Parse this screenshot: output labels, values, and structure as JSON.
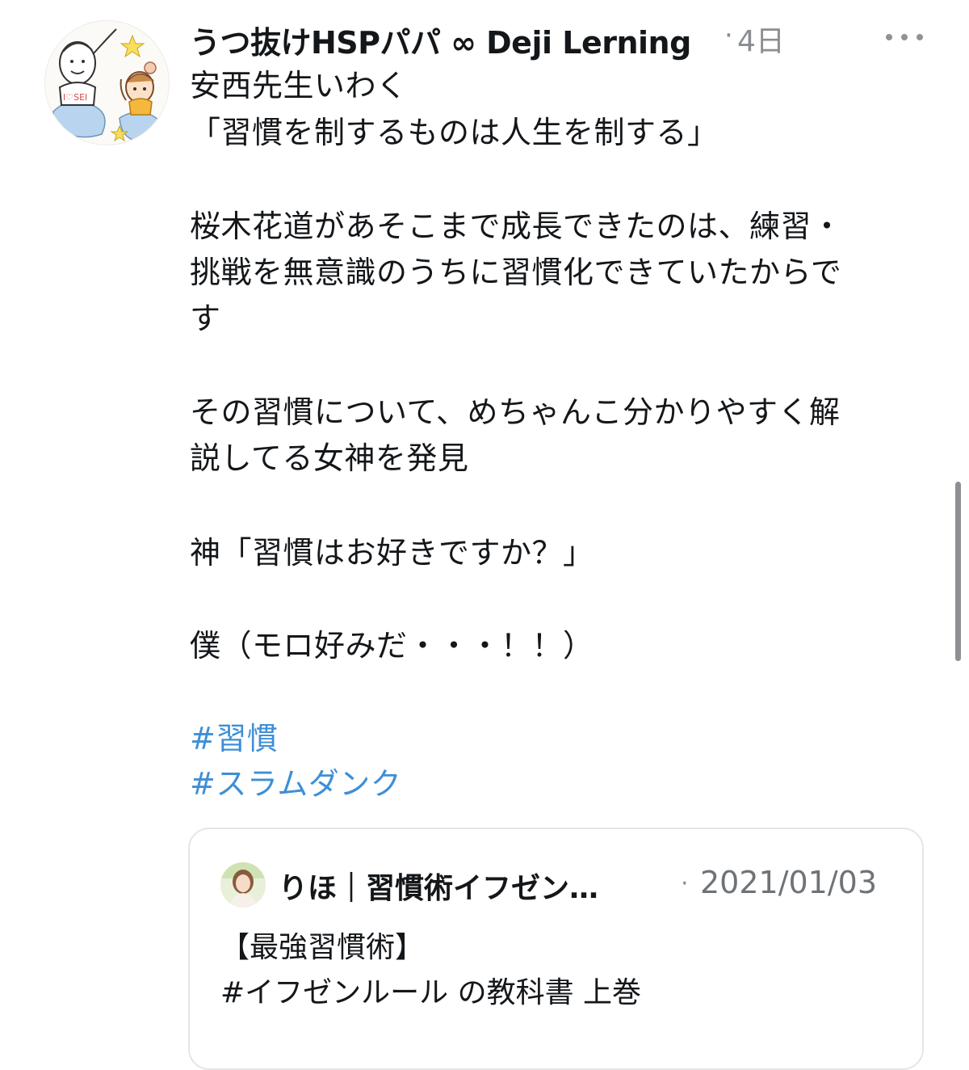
{
  "tweet": {
    "author": {
      "display_name": "うつ抜けHSPパパ ∞ Deji Lerning",
      "avatar": "illustrated-avatar-icon",
      "avatar_caption": "I♡SEI"
    },
    "time_separator": "·",
    "timestamp": "4日",
    "more_icon": "more-horizontal-icon",
    "text": {
      "line1": "安西先生いわく",
      "line2": "「習慣を制するものは人生を制する」",
      "line3": "桜木花道があそこまで成長できたのは、練習・",
      "line4": "挑戦を無意識のうちに習慣化できていたからで",
      "line5": "す",
      "line6": "その習慣について、めちゃんこ分かりやすく解",
      "line7": "説してる女神を発見",
      "line8": "神「習慣はお好きですか？」",
      "line9": "僕（モロ好みだ・・・！！）"
    },
    "hashtags": {
      "tag1": "#習慣",
      "tag2": "#スラムダンク"
    }
  },
  "quote": {
    "avatar": "user-photo-avatar-icon",
    "author": "りほ｜習慣術イフゼン…",
    "time_separator": "·",
    "date": "2021/01/03",
    "line1": "【最強習慣術】",
    "line2": "#イフゼンルール の教科書 上巻"
  },
  "colors": {
    "text": "#14171a",
    "secondary": "#8a8d91",
    "hashtag": "#3e8fd6",
    "border": "#e3e6e9"
  }
}
